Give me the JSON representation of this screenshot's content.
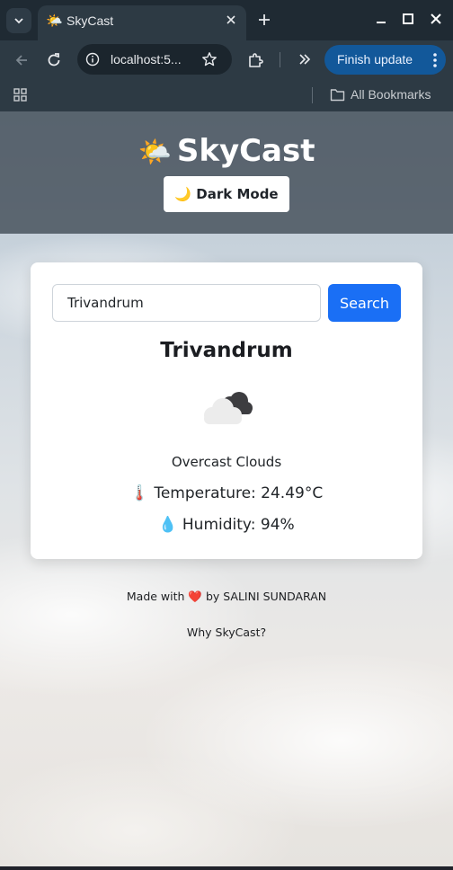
{
  "browser": {
    "tab": {
      "favicon": "🌤️",
      "title": "SkyCast"
    },
    "url": "localhost:5...",
    "finish_update_label": "Finish update",
    "bookmarks_label": "All Bookmarks"
  },
  "header": {
    "logo": "🌤️",
    "title": "SkyCast",
    "dark_mode_label": "🌙 Dark Mode"
  },
  "search": {
    "value": "Trivandrum",
    "button_label": "Search"
  },
  "weather": {
    "city": "Trivandrum",
    "icon": "overcast-clouds-icon",
    "description": "Overcast Clouds",
    "temperature_label": "🌡️ Temperature: 24.49°C",
    "humidity_label": "💧 Humidity: 94%"
  },
  "footer": {
    "made_with": "Made with ❤️ by SALINI SUNDARAN",
    "why_link": "Why SkyCast?"
  }
}
